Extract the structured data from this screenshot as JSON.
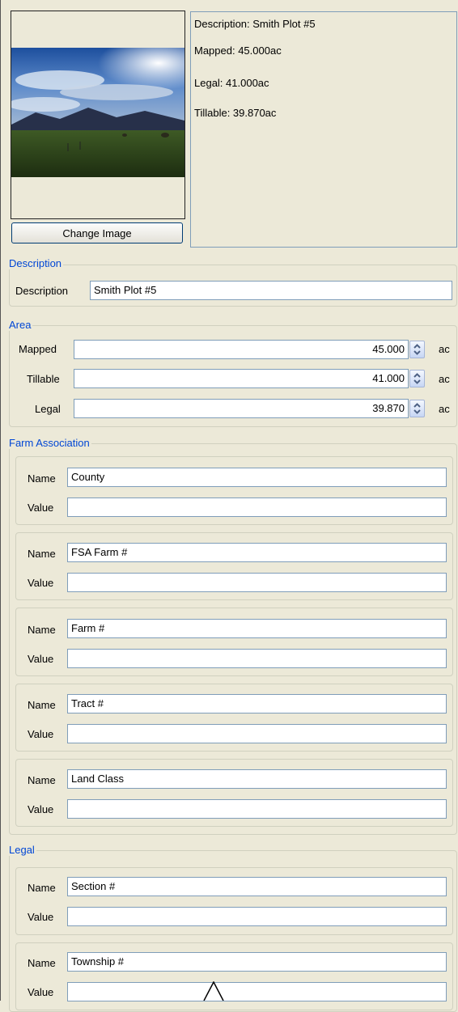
{
  "image_panel": {
    "change_image_label": "Change Image"
  },
  "info": {
    "description_line": "Description: Smith Plot #5",
    "mapped_line": "Mapped: 45.000ac",
    "legal_line": "Legal: 41.000ac",
    "tillable_line": "Tillable: 39.870ac"
  },
  "description_group": {
    "legend": "Description",
    "label": "Description",
    "value": "Smith Plot #5"
  },
  "area_group": {
    "legend": "Area",
    "rows": [
      {
        "label": "Mapped",
        "value": "45.000",
        "unit": "ac"
      },
      {
        "label": "Tillable",
        "value": "41.000",
        "unit": "ac"
      },
      {
        "label": "Legal",
        "value": "39.870",
        "unit": "ac"
      }
    ]
  },
  "farm_group": {
    "legend": "Farm Association",
    "name_label": "Name",
    "value_label": "Value",
    "items": [
      {
        "name": "County",
        "value": ""
      },
      {
        "name": "FSA Farm #",
        "value": ""
      },
      {
        "name": "Farm #",
        "value": ""
      },
      {
        "name": "Tract #",
        "value": ""
      },
      {
        "name": "Land Class",
        "value": ""
      }
    ]
  },
  "legal_group": {
    "legend": "Legal",
    "name_label": "Name",
    "value_label": "Value",
    "items": [
      {
        "name": "Section #",
        "value": ""
      },
      {
        "name": "Township #",
        "value": ""
      }
    ]
  },
  "icons": {
    "spinner": "spin-up-down-icon",
    "cursor": "text-cursor-icon"
  },
  "colors": {
    "background": "#ece9d8",
    "legend_text": "#0046d5",
    "field_border": "#7f9db9"
  }
}
